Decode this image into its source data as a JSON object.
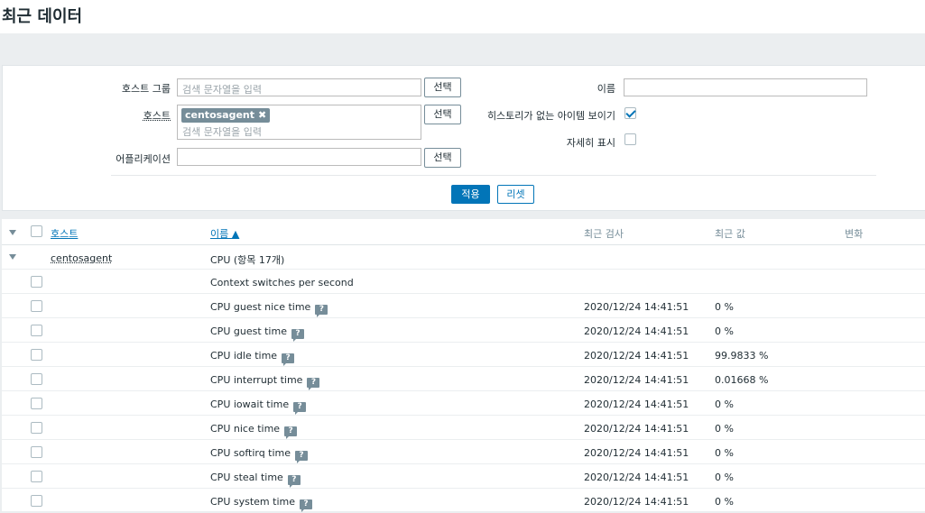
{
  "page": {
    "title": "최근 데이터"
  },
  "filter": {
    "host_groups": {
      "label": "호스트 그룹",
      "placeholder": "검색 문자열을 입력",
      "select": "선택"
    },
    "hosts": {
      "label": "호스트",
      "chip": "centosagent",
      "chip_remove": "✖",
      "placeholder": "검색 문자열을 입력",
      "select": "선택"
    },
    "application": {
      "label": "어플리케이션",
      "value": "",
      "select": "선택"
    },
    "name": {
      "label": "이름",
      "value": ""
    },
    "show_without_history": {
      "label": "히스토리가 없는 아이템 보이기",
      "checked": true
    },
    "show_details": {
      "label": "자세히 표시",
      "checked": false
    },
    "apply": "적용",
    "reset": "리셋"
  },
  "table": {
    "headers": {
      "host": "호스트",
      "name": "이름 ▲",
      "last_check": "최근 검사",
      "last_value": "최근 값",
      "change": "변화"
    },
    "group": {
      "host": "centosagent",
      "title": "CPU (항목 17개)"
    },
    "rows": [
      {
        "name": "Context switches per second",
        "last_check": "",
        "last_value": "",
        "hint": false
      },
      {
        "name": "CPU guest nice time",
        "last_check": "2020/12/24 14:41:51",
        "last_value": "0 %",
        "hint": true
      },
      {
        "name": "CPU guest time",
        "last_check": "2020/12/24 14:41:51",
        "last_value": "0 %",
        "hint": true
      },
      {
        "name": "CPU idle time",
        "last_check": "2020/12/24 14:41:51",
        "last_value": "99.9833 %",
        "hint": true
      },
      {
        "name": "CPU interrupt time",
        "last_check": "2020/12/24 14:41:51",
        "last_value": "0.01668 %",
        "hint": true
      },
      {
        "name": "CPU iowait time",
        "last_check": "2020/12/24 14:41:51",
        "last_value": "0 %",
        "hint": true
      },
      {
        "name": "CPU nice time",
        "last_check": "2020/12/24 14:41:51",
        "last_value": "0 %",
        "hint": true
      },
      {
        "name": "CPU softirq time",
        "last_check": "2020/12/24 14:41:51",
        "last_value": "0 %",
        "hint": true
      },
      {
        "name": "CPU steal time",
        "last_check": "2020/12/24 14:41:51",
        "last_value": "0 %",
        "hint": true
      },
      {
        "name": "CPU system time",
        "last_check": "2020/12/24 14:41:51",
        "last_value": "0 %",
        "hint": true
      }
    ],
    "hint_glyph": "?"
  }
}
